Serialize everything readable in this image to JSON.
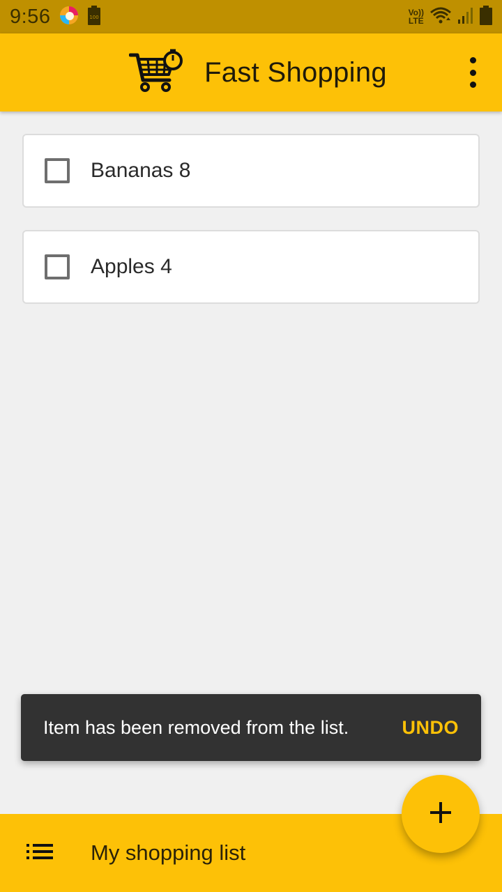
{
  "status_bar": {
    "time": "9:56",
    "icons": [
      "firefox-focus-icon",
      "battery-100-icon",
      "volte-lte-icon",
      "wifi-icon",
      "signal-icon",
      "battery-icon"
    ],
    "volte_line1": "Vo))",
    "volte_line2": "LTE",
    "battery_small_label": "100"
  },
  "app_bar": {
    "title": "Fast Shopping",
    "logo_icon": "cart-timer-icon",
    "menu_icon": "more-vert-icon"
  },
  "items": [
    {
      "label": "Bananas 8",
      "checked": false
    },
    {
      "label": "Apples 4",
      "checked": false
    }
  ],
  "snackbar": {
    "message": "Item has been removed from the list.",
    "action": "UNDO"
  },
  "bottom_bar": {
    "icon": "list-icon",
    "title": "My shopping list"
  },
  "fab": {
    "icon": "add-icon"
  },
  "colors": {
    "accent": "#fdc107",
    "status_bar": "#bf9000",
    "background": "#f0f0f0",
    "snackbar": "#323232"
  }
}
